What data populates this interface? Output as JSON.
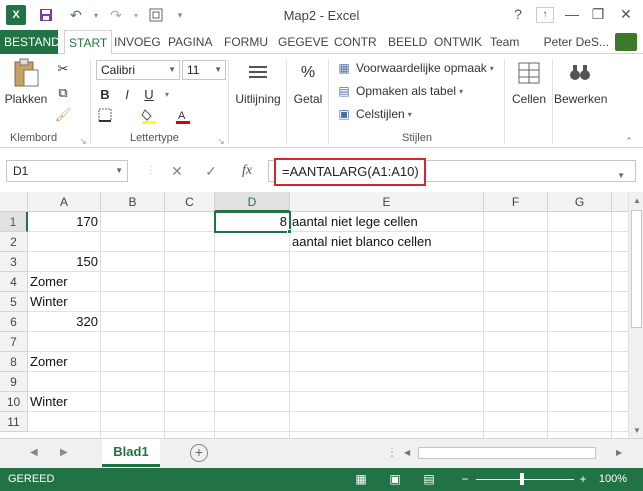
{
  "window": {
    "title": "Map2 - Excel",
    "help": "?",
    "minimize": "—",
    "restore": "❐",
    "close": "✕"
  },
  "ribbon_tabs": {
    "file": "BESTAND",
    "items": [
      "START",
      "INVOEG",
      "PAGINA",
      "FORMU",
      "GEGEVE",
      "CONTR",
      "BEELD",
      "ONTWIK",
      "Team"
    ],
    "user": "Peter DeS..."
  },
  "ribbon": {
    "clipboard": {
      "paste": "Plakken",
      "group": "Klembord"
    },
    "font": {
      "name": "Calibri",
      "size": "11",
      "group": "Lettertype",
      "bold": "B",
      "italic": "I",
      "underline": "U"
    },
    "alignment": {
      "label": "Uitlijning"
    },
    "number": {
      "label": "Getal",
      "symbol": "%"
    },
    "styles": {
      "conditional": "Voorwaardelijke opmaak",
      "table": "Opmaken als tabel",
      "cell_styles": "Celstijlen",
      "group": "Stijlen"
    },
    "cells": {
      "label": "Cellen"
    },
    "editing": {
      "label": "Bewerken"
    }
  },
  "formula_bar": {
    "name_box": "D1",
    "cancel": "✕",
    "enter": "✓",
    "fx": "fx",
    "formula": "=AANTALARG(A1:A10)"
  },
  "grid": {
    "columns": [
      "A",
      "B",
      "C",
      "D",
      "E",
      "F",
      "G"
    ],
    "rows": [
      "1",
      "2",
      "3",
      "4",
      "5",
      "6",
      "7",
      "8",
      "9",
      "10",
      "11"
    ],
    "cells": {
      "A1": "170",
      "A3": "150",
      "A4": "Zomer",
      "A5": "Winter",
      "A6": "320",
      "A8": "Zomer",
      "A10": "Winter",
      "D1": "8",
      "E1": "aantal niet lege cellen",
      "E2": "aantal niet blanco cellen"
    }
  },
  "sheets": {
    "active": "Blad1",
    "add": "+"
  },
  "status": {
    "text": "GEREED",
    "zoom": "100%",
    "zoom_minus": "−",
    "zoom_plus": "+"
  },
  "colors": {
    "accent": "#217346",
    "highlight": "#d62828"
  }
}
